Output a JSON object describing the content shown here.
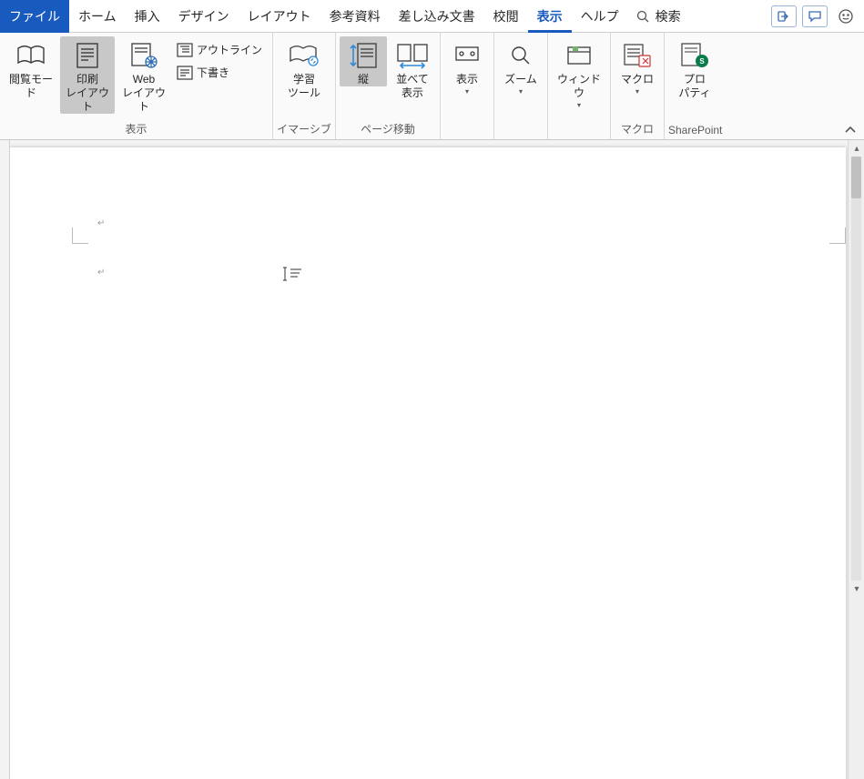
{
  "menu": {
    "file": "ファイル",
    "tabs": [
      "ホーム",
      "挿入",
      "デザイン",
      "レイアウト",
      "参考資料",
      "差し込み文書",
      "校閲",
      "表示",
      "ヘルプ"
    ],
    "active_tab_index": 7,
    "search_label": "検索"
  },
  "ribbon": {
    "group_view": {
      "label": "表示",
      "read_mode": "閲覧モード",
      "print_layout": "印刷\nレイアウト",
      "web_layout": "Web\nレイアウト",
      "outline": "アウトライン",
      "draft": "下書き"
    },
    "group_immersive": {
      "label": "イマーシブ",
      "learning_tools": "学習\nツール"
    },
    "group_page_move": {
      "label": "ページ移動",
      "vertical": "縦",
      "side_by_side": "並べて\n表示"
    },
    "group_show": {
      "label": "",
      "show": "表示"
    },
    "group_zoom": {
      "label": "",
      "zoom": "ズーム"
    },
    "group_window": {
      "label": "",
      "window": "ウィンドウ"
    },
    "group_macro": {
      "label": "マクロ",
      "macro": "マクロ"
    },
    "group_sp": {
      "label": "SharePoint",
      "property": "プロ\nパティ"
    }
  },
  "doc": {
    "para_mark": "↵"
  },
  "colors": {
    "brand": "#185abd",
    "ribbon_bg": "#fafafa",
    "selected": "#c8c8c8"
  }
}
